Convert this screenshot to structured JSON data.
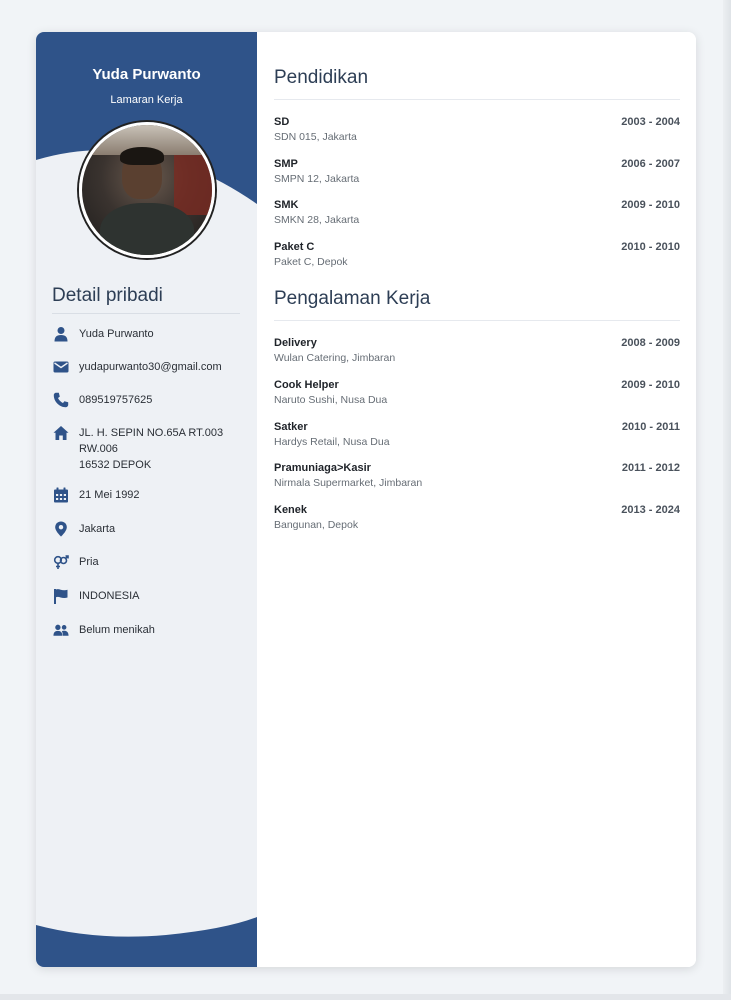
{
  "profile": {
    "name": "Yuda Purwanto",
    "subtitle": "Lamaran Kerja"
  },
  "colors": {
    "primary": "#2f5389",
    "sidebar_bg": "#eef1f5",
    "text": "#2d3e55"
  },
  "personal": {
    "title": "Detail pribadi",
    "items": [
      {
        "icon": "person-icon",
        "label": "Yuda Purwanto"
      },
      {
        "icon": "email-icon",
        "label": "yudapurwanto30@gmail.com"
      },
      {
        "icon": "phone-icon",
        "label": "089519757625"
      },
      {
        "icon": "home-icon",
        "line1": "JL. H. SEPIN NO.65A RT.003",
        "line2": "RW.006",
        "line3": "16532 DEPOK"
      },
      {
        "icon": "calendar-icon",
        "label": "21 Mei 1992"
      },
      {
        "icon": "location-pin-icon",
        "label": "Jakarta"
      },
      {
        "icon": "gender-icon",
        "label": "Pria"
      },
      {
        "icon": "flag-icon",
        "label": "INDONESIA"
      },
      {
        "icon": "group-icon",
        "label": "Belum menikah"
      }
    ]
  },
  "education": {
    "title": "Pendidikan",
    "items": [
      {
        "title": "SD",
        "place": "SDN 015, Jakarta",
        "dates": "2003 - 2004"
      },
      {
        "title": "SMP",
        "place": "SMPN 12, Jakarta",
        "dates": "2006 - 2007"
      },
      {
        "title": "SMK",
        "place": "SMKN 28, Jakarta",
        "dates": "2009 - 2010"
      },
      {
        "title": "Paket C",
        "place": "Paket C, Depok",
        "dates": "2010 - 2010"
      }
    ]
  },
  "experience": {
    "title": "Pengalaman Kerja",
    "items": [
      {
        "title": "Delivery",
        "place": "Wulan Catering, Jimbaran",
        "dates": "2008 - 2009"
      },
      {
        "title": "Cook Helper",
        "place": "Naruto Sushi, Nusa Dua",
        "dates": "2009 - 2010"
      },
      {
        "title": "Satker",
        "place": "Hardys Retail, Nusa Dua",
        "dates": "2010 - 2011"
      },
      {
        "title": "Pramuniaga>Kasir",
        "place": "Nirmala Supermarket, Jimbaran",
        "dates": "2011 - 2012"
      },
      {
        "title": "Kenek",
        "place": "Bangunan, Depok",
        "dates": "2013 - 2024"
      }
    ]
  }
}
